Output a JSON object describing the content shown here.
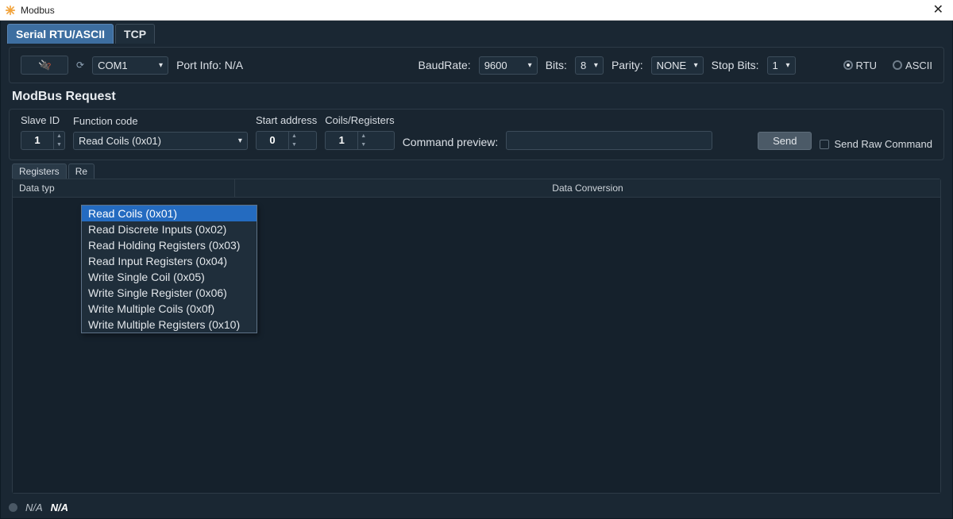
{
  "window": {
    "title": "Modbus"
  },
  "tabs": {
    "serial": "Serial RTU/ASCII",
    "tcp": "TCP"
  },
  "connection": {
    "port_value": "COM1",
    "port_info_label": "Port Info:",
    "port_info_value": "N/A",
    "baudrate_label": "BaudRate:",
    "baudrate_value": "9600",
    "bits_label": "Bits:",
    "bits_value": "8",
    "parity_label": "Parity:",
    "parity_value": "NONE",
    "stopbits_label": "Stop Bits:",
    "stopbits_value": "1",
    "mode_rtu": "RTU",
    "mode_ascii": "ASCII"
  },
  "request": {
    "title": "ModBus Request",
    "slave_id_label": "Slave ID",
    "slave_id_value": "1",
    "function_code_label": "Function code",
    "function_code_value": "Read Coils (0x01)",
    "start_address_label": "Start address",
    "start_address_value": "0",
    "coils_registers_label": "Coils/Registers",
    "coils_registers_value": "1",
    "command_preview_label": "Command preview:",
    "command_preview_value": "",
    "send_button": "Send",
    "send_raw_checkbox": "Send Raw Command"
  },
  "function_codes": [
    "Read Coils (0x01)",
    "Read Discrete Inputs (0x02)",
    "Read Holding Registers (0x03)",
    "Read Input Registers (0x04)",
    "Write Single Coil (0x05)",
    "Write Single Register (0x06)",
    "Write Multiple Coils (0x0f)",
    "Write Multiple Registers (0x10)"
  ],
  "registers": {
    "tab_registers": "Registers",
    "tab_re_partial": "Re",
    "header_datatype": "Data typ",
    "header_dataconversion": "Data Conversion"
  },
  "status": {
    "na1": "N/A",
    "na2": "N/A"
  }
}
